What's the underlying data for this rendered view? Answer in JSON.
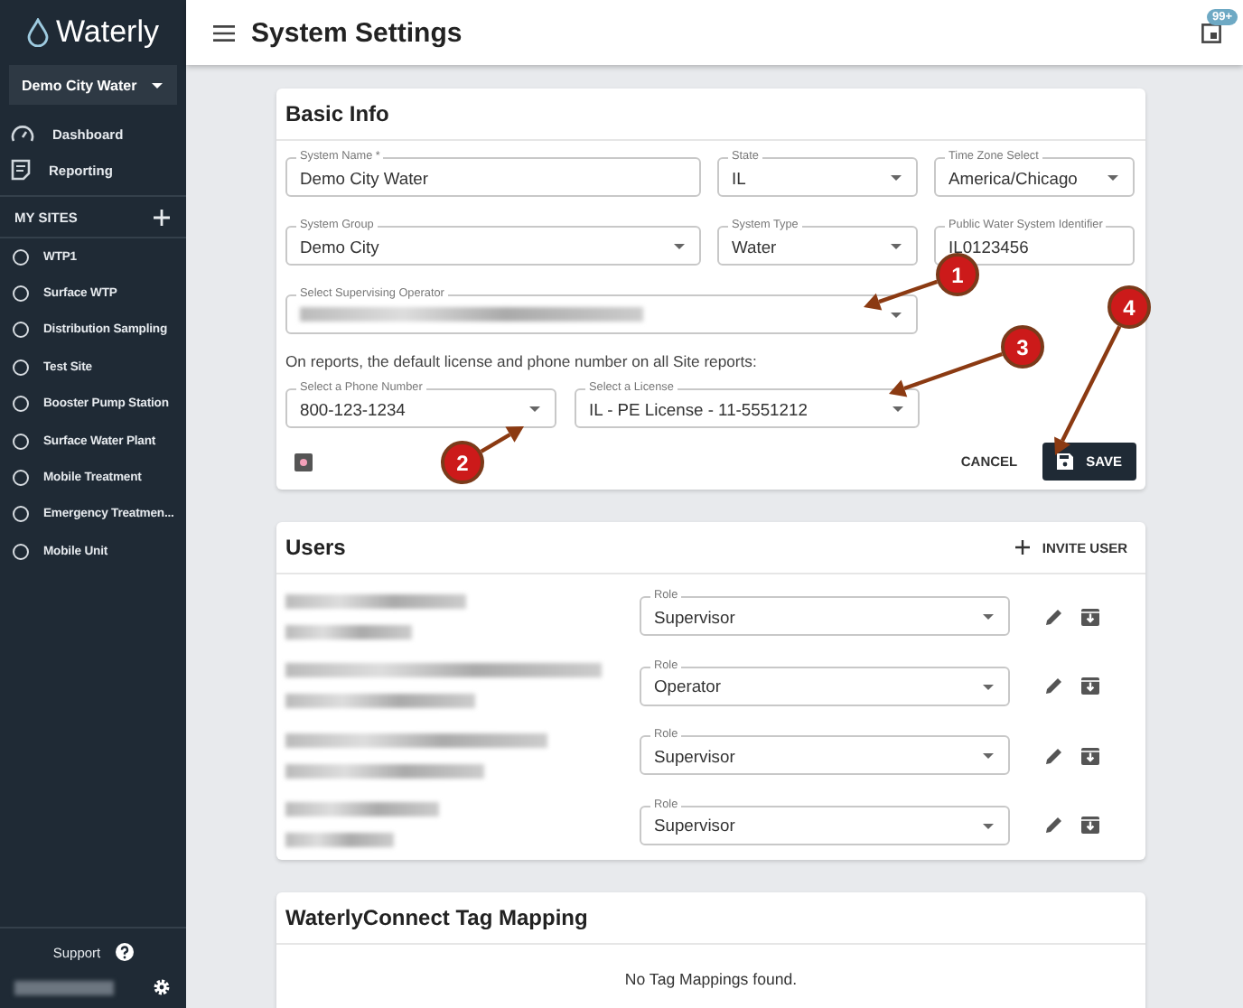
{
  "sidebar": {
    "logo": "Waterly",
    "system_select": "Demo City Water",
    "nav": [
      {
        "label": "Dashboard",
        "kind": "gauge"
      },
      {
        "label": "Reporting",
        "kind": "report"
      }
    ],
    "sites_header": "MY SITES",
    "sites": [
      "WTP1",
      "Surface WTP",
      "Distribution Sampling",
      "Test Site",
      "Booster Pump Station",
      "Surface Water Plant",
      "Mobile Treatment",
      "Emergency Treatmen...",
      "Mobile Unit"
    ],
    "support": "Support"
  },
  "topbar": {
    "title": "System Settings",
    "badge": "99+"
  },
  "basic_info": {
    "title": "Basic Info",
    "fields": [
      {
        "label": "System Name *",
        "value": "Demo City Water",
        "kind": "text"
      },
      {
        "label": "State",
        "value": "IL",
        "kind": "select"
      },
      {
        "label": "Time Zone Select",
        "value": "America/Chicago",
        "kind": "select"
      },
      {
        "label": "System Group",
        "value": "Demo City",
        "kind": "select"
      },
      {
        "label": "System Type",
        "value": "Water",
        "kind": "select"
      },
      {
        "label": "Public Water System Identifier",
        "value": "IL0123456",
        "kind": "text"
      }
    ],
    "operator": {
      "label": "Select Supervising Operator",
      "redacted": true
    },
    "note": "On reports, the default license and phone number on all Site reports:",
    "phone": {
      "label": "Select a Phone Number",
      "value": "800-123-1234"
    },
    "license": {
      "label": "Select a License",
      "value": "IL - PE License - 11-5551212"
    },
    "cancel": "CANCEL",
    "save": "SAVE"
  },
  "users": {
    "title": "Users",
    "invite": "INVITE USER",
    "rows": [
      {
        "role_label": "Role",
        "role": "Supervisor"
      },
      {
        "role_label": "Role",
        "role": "Operator"
      },
      {
        "role_label": "Role",
        "role": "Supervisor"
      },
      {
        "role_label": "Role",
        "role": "Supervisor"
      }
    ]
  },
  "tag_mapping": {
    "title": "WaterlyConnect Tag Mapping",
    "empty": "No Tag Mappings found."
  },
  "annotations": [
    {
      "number": "1"
    },
    {
      "number": "2"
    },
    {
      "number": "3"
    },
    {
      "number": "4"
    }
  ]
}
